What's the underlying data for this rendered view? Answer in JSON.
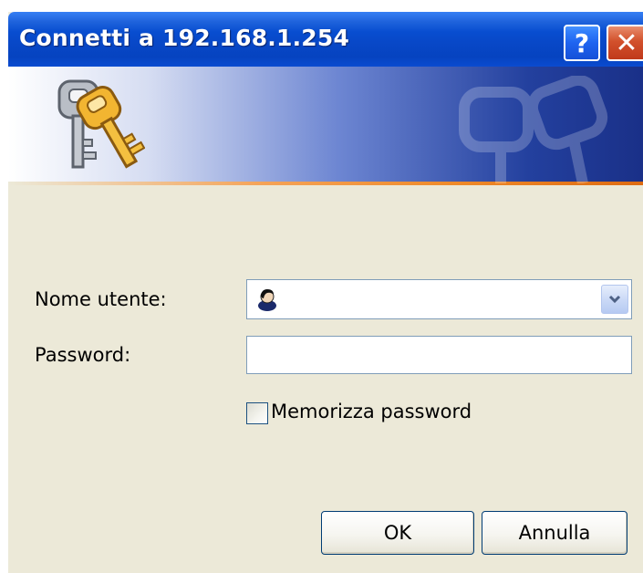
{
  "window": {
    "title": "Connetti a 192.168.1.254"
  },
  "titlebar_buttons": {
    "help_label": "?",
    "close_label": "✕"
  },
  "form": {
    "username_label": "Nome utente:",
    "username_value": "",
    "password_label": "Password:",
    "password_value": "",
    "remember_label": "Memorizza password",
    "remember_checked": false
  },
  "buttons": {
    "ok_label": "OK",
    "cancel_label": "Annulla"
  },
  "icons": {
    "banner": "keys-icon",
    "user": "user-icon",
    "dropdown": "chevron-down-icon"
  },
  "colors": {
    "titlebar": "#0848c8",
    "dialog_bg": "#ece9d8",
    "accent_line": "#ee8a2a",
    "close_button": "#c0391b"
  }
}
